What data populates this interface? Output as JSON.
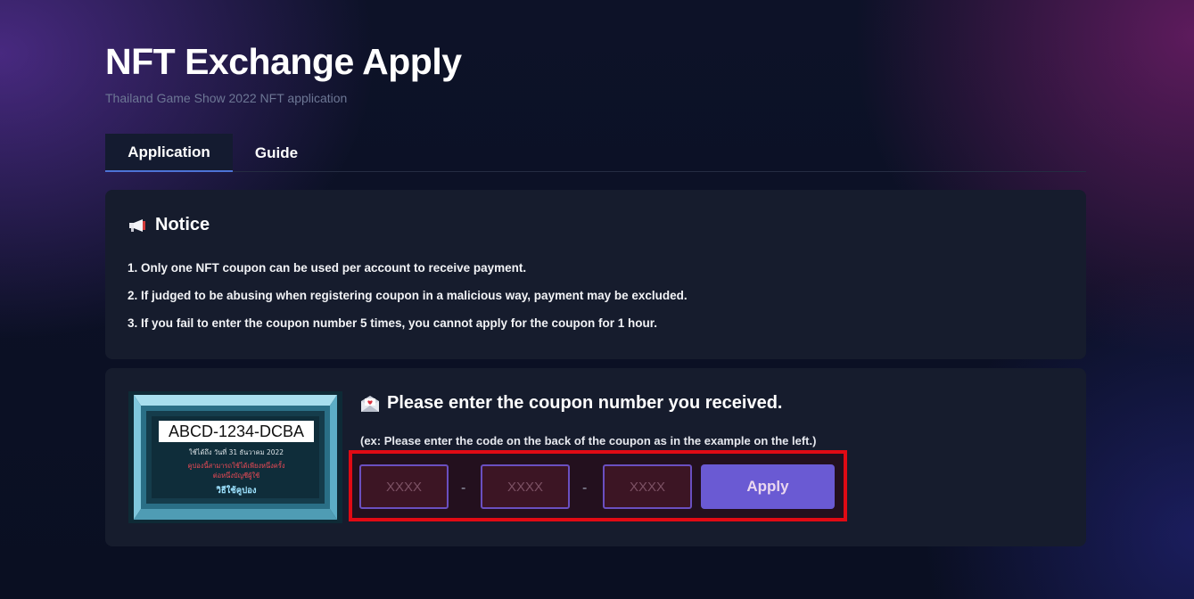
{
  "header": {
    "title": "NFT Exchange Apply",
    "subtitle": "Thailand Game Show 2022 NFT application"
  },
  "tabs": [
    {
      "label": "Application",
      "active": true
    },
    {
      "label": "Guide",
      "active": false
    }
  ],
  "notice": {
    "icon": "megaphone-icon",
    "title": "Notice",
    "items": [
      "1. Only one NFT coupon can be used per account to receive payment.",
      "2. If judged to be abusing when registering coupon in a malicious way, payment may be excluded.",
      "3. If you fail to enter the coupon number 5 times, you cannot apply for the coupon for 1 hour."
    ]
  },
  "coupon": {
    "icon": "envelope-heart-icon",
    "title": "Please enter the coupon number you received.",
    "hint": "(ex: Please enter the code on the back of the coupon as in the example on the left.)",
    "sample": {
      "code": "ABCD-1234-DCBA",
      "expiry": "ใช้ได้ถึง วันที่ 31 ธันวาคม 2022",
      "warning_line1": "คูปองนี้สามารถใช้ได้เพียงหนึ่งครั้ง",
      "warning_line2": "ต่อหนึ่งบัญชีผู้ใช้",
      "howto": "วิธีใช้คูปอง"
    },
    "inputs": [
      {
        "placeholder": "XXXX",
        "value": ""
      },
      {
        "placeholder": "XXXX",
        "value": ""
      },
      {
        "placeholder": "XXXX",
        "value": ""
      }
    ],
    "separator": "-",
    "apply_label": "Apply"
  },
  "colors": {
    "accent": "#6a5ad3",
    "tab_underline": "#4d73d6",
    "highlight_border": "#e10a14",
    "card_bg": "#161c2d"
  }
}
